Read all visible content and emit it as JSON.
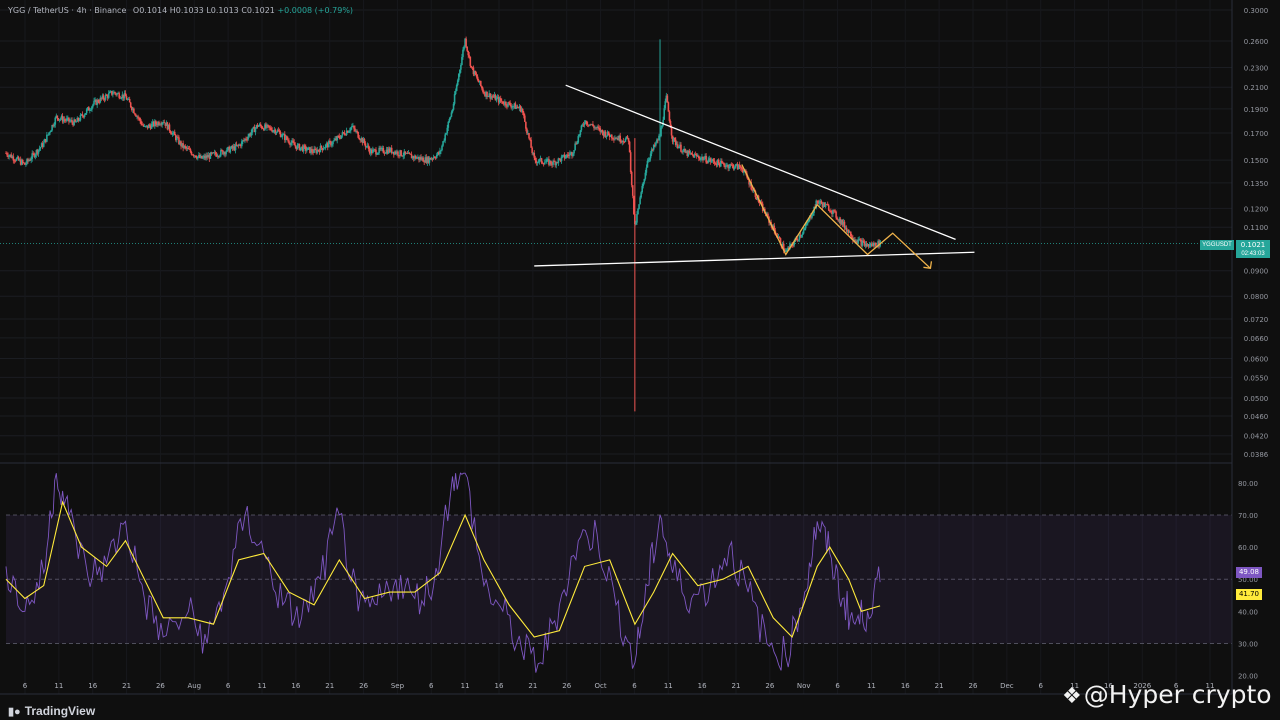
{
  "header": {
    "symbol": "YGG / TetherUS · 4h · Binance",
    "open": "O0.1014",
    "high": "H0.1033",
    "low": "L0.1013",
    "close": "C0.1021",
    "change": "+0.0008 (+0.79%)"
  },
  "price_tags": {
    "symbol": "YGGUSDT",
    "current": "0.1021",
    "countdown": "02:43:03"
  },
  "rsi_tags": {
    "rsi": "49.08",
    "rsi_ma": "41.70"
  },
  "colors": {
    "background": "#0f0f0f",
    "bull": "#26a69a",
    "bear": "#ef5350",
    "rsi_line": "#7e57c2",
    "rsi_ma": "#ffeb3b",
    "pattern": "#f0b34b",
    "trendline": "#ffffff"
  },
  "branding": {
    "logo_text": "TradingView",
    "watermark": "@Hyper  crypto"
  },
  "chart_data": [
    {
      "type": "candlestick",
      "pair": "YGG/USDT",
      "interval": "4h",
      "scale": "log",
      "ylim": [
        0.0386,
        0.3
      ],
      "y_ticks": [
        "0.3000",
        "0.2600",
        "0.2300",
        "0.2100",
        "0.1900",
        "0.1700",
        "0.1500",
        "0.1350",
        "0.1200",
        "0.1100",
        "0.0900",
        "0.0800",
        "0.0720",
        "0.0660",
        "0.0600",
        "0.0550",
        "0.0500",
        "0.0460",
        "0.0420",
        "0.0386"
      ],
      "x_ticks": [
        "6",
        "11",
        "16",
        "21",
        "26",
        "Aug",
        "6",
        "11",
        "16",
        "21",
        "26",
        "Sep",
        "6",
        "11",
        "16",
        "21",
        "26",
        "Oct",
        "6",
        "11",
        "16",
        "21",
        "26",
        "Nov",
        "6",
        "11",
        "16",
        "21",
        "26",
        "Dec",
        "6",
        "11",
        "16",
        "2026",
        "6",
        "11"
      ],
      "x_range": [
        "2025-07-03",
        "2026-01-13"
      ],
      "series_close": [
        [
          "2025-07-03",
          0.155
        ],
        [
          "2025-07-06",
          0.147
        ],
        [
          "2025-07-09",
          0.162
        ],
        [
          "2025-07-11",
          0.183
        ],
        [
          "2025-07-14",
          0.178
        ],
        [
          "2025-07-17",
          0.195
        ],
        [
          "2025-07-20",
          0.205
        ],
        [
          "2025-07-22",
          0.201
        ],
        [
          "2025-07-25",
          0.174
        ],
        [
          "2025-07-28",
          0.18
        ],
        [
          "2025-07-31",
          0.16
        ],
        [
          "2025-08-03",
          0.151
        ],
        [
          "2025-08-06",
          0.155
        ],
        [
          "2025-08-09",
          0.16
        ],
        [
          "2025-08-12",
          0.176
        ],
        [
          "2025-08-15",
          0.172
        ],
        [
          "2025-08-18",
          0.16
        ],
        [
          "2025-08-21",
          0.156
        ],
        [
          "2025-08-24",
          0.163
        ],
        [
          "2025-08-27",
          0.175
        ],
        [
          "2025-08-30",
          0.156
        ],
        [
          "2025-09-02",
          0.157
        ],
        [
          "2025-09-05",
          0.153
        ],
        [
          "2025-09-08",
          0.15
        ],
        [
          "2025-09-10",
          0.155
        ],
        [
          "2025-09-12",
          0.19
        ],
        [
          "2025-09-14",
          0.262
        ],
        [
          "2025-09-15",
          0.23
        ],
        [
          "2025-09-17",
          0.205
        ],
        [
          "2025-09-20",
          0.196
        ],
        [
          "2025-09-23",
          0.19
        ],
        [
          "2025-09-25",
          0.15
        ],
        [
          "2025-09-28",
          0.148
        ],
        [
          "2025-10-01",
          0.155
        ],
        [
          "2025-10-03",
          0.18
        ],
        [
          "2025-10-06",
          0.17
        ],
        [
          "2025-10-09",
          0.165
        ],
        [
          "2025-10-10",
          0.165
        ],
        [
          "2025-10-11",
          0.11
        ],
        [
          "2025-10-13",
          0.15
        ],
        [
          "2025-10-15",
          0.168
        ],
        [
          "2025-10-16",
          0.2
        ],
        [
          "2025-10-17",
          0.165
        ],
        [
          "2025-10-19",
          0.155
        ],
        [
          "2025-10-22",
          0.151
        ],
        [
          "2025-10-25",
          0.147
        ],
        [
          "2025-10-28",
          0.145
        ],
        [
          "2025-10-31",
          0.122
        ],
        [
          "2025-11-04",
          0.098
        ],
        [
          "2025-11-07",
          0.109
        ],
        [
          "2025-11-09",
          0.124
        ],
        [
          "2025-11-11",
          0.12
        ],
        [
          "2025-11-13",
          0.112
        ],
        [
          "2025-11-15",
          0.104
        ],
        [
          "2025-11-17",
          0.101
        ],
        [
          "2025-11-19",
          0.1021
        ]
      ],
      "wicks": {
        "2025-10-11": {
          "low": 0.047,
          "high": 0.166
        },
        "2025-10-15": {
          "low": 0.15,
          "high": 0.262
        }
      },
      "annotations": {
        "descending_trendline": [
          [
            "2025-09-30",
            0.212
          ],
          [
            "2025-12-01",
            0.104
          ]
        ],
        "support_line": [
          [
            "2025-09-25",
            0.092
          ],
          [
            "2025-12-04",
            0.098
          ]
        ],
        "pattern_path": [
          [
            "2025-10-28",
            0.147
          ],
          [
            "2025-11-04",
            0.097
          ],
          [
            "2025-11-09",
            0.122
          ],
          [
            "2025-11-17",
            0.097
          ],
          [
            "2025-11-21",
            0.107
          ],
          [
            "2025-11-27",
            0.091
          ]
        ]
      }
    },
    {
      "type": "line",
      "indicator": "RSI",
      "ylim": [
        18,
        84
      ],
      "y_ticks": [
        "80.00",
        "70.00",
        "60.00",
        "50.00",
        "40.00",
        "30.00",
        "20.00"
      ],
      "band": [
        30,
        70
      ],
      "midline": 50,
      "series": [
        {
          "name": "RSI",
          "values": [
            [
              "2025-07-03",
              54
            ],
            [
              "2025-07-06",
              40
            ],
            [
              "2025-07-09",
              52
            ],
            [
              "2025-07-11",
              84
            ],
            [
              "2025-07-13",
              70
            ],
            [
              "2025-07-16",
              51
            ],
            [
              "2025-07-19",
              55
            ],
            [
              "2025-07-22",
              68
            ],
            [
              "2025-07-25",
              44
            ],
            [
              "2025-07-28",
              32
            ],
            [
              "2025-08-01",
              40
            ],
            [
              "2025-08-04",
              30
            ],
            [
              "2025-08-07",
              48
            ],
            [
              "2025-08-10",
              70
            ],
            [
              "2025-08-13",
              58
            ],
            [
              "2025-08-16",
              42
            ],
            [
              "2025-08-19",
              38
            ],
            [
              "2025-08-22",
              50
            ],
            [
              "2025-08-25",
              70
            ],
            [
              "2025-08-28",
              40
            ],
            [
              "2025-08-31",
              42
            ],
            [
              "2025-09-03",
              50
            ],
            [
              "2025-09-06",
              44
            ],
            [
              "2025-09-09",
              48
            ],
            [
              "2025-09-12",
              82
            ],
            [
              "2025-09-14",
              84
            ],
            [
              "2025-09-17",
              48
            ],
            [
              "2025-09-20",
              40
            ],
            [
              "2025-09-23",
              28
            ],
            [
              "2025-09-26",
              24
            ],
            [
              "2025-09-29",
              42
            ],
            [
              "2025-10-02",
              62
            ],
            [
              "2025-10-05",
              64
            ],
            [
              "2025-10-08",
              42
            ],
            [
              "2025-10-11",
              24
            ],
            [
              "2025-10-13",
              48
            ],
            [
              "2025-10-15",
              70
            ],
            [
              "2025-10-17",
              52
            ],
            [
              "2025-10-20",
              44
            ],
            [
              "2025-10-23",
              48
            ],
            [
              "2025-10-26",
              60
            ],
            [
              "2025-10-29",
              46
            ],
            [
              "2025-11-01",
              30
            ],
            [
              "2025-11-04",
              26
            ],
            [
              "2025-11-07",
              46
            ],
            [
              "2025-11-09",
              68
            ],
            [
              "2025-11-11",
              58
            ],
            [
              "2025-11-13",
              44
            ],
            [
              "2025-11-15",
              36
            ],
            [
              "2025-11-17",
              40
            ],
            [
              "2025-11-19",
              49.08
            ]
          ]
        },
        {
          "name": "RSI MA",
          "values": [
            [
              "2025-07-03",
              50
            ],
            [
              "2025-07-06",
              44
            ],
            [
              "2025-07-09",
              48
            ],
            [
              "2025-07-12",
              74
            ],
            [
              "2025-07-15",
              60
            ],
            [
              "2025-07-19",
              54
            ],
            [
              "2025-07-22",
              62
            ],
            [
              "2025-07-25",
              50
            ],
            [
              "2025-07-28",
              38
            ],
            [
              "2025-08-01",
              38
            ],
            [
              "2025-08-05",
              36
            ],
            [
              "2025-08-09",
              56
            ],
            [
              "2025-08-13",
              58
            ],
            [
              "2025-08-17",
              46
            ],
            [
              "2025-08-21",
              42
            ],
            [
              "2025-08-25",
              56
            ],
            [
              "2025-08-29",
              44
            ],
            [
              "2025-09-02",
              46
            ],
            [
              "2025-09-06",
              46
            ],
            [
              "2025-09-10",
              52
            ],
            [
              "2025-09-14",
              70
            ],
            [
              "2025-09-17",
              56
            ],
            [
              "2025-09-21",
              42
            ],
            [
              "2025-09-25",
              32
            ],
            [
              "2025-09-29",
              34
            ],
            [
              "2025-10-03",
              54
            ],
            [
              "2025-10-07",
              56
            ],
            [
              "2025-10-11",
              36
            ],
            [
              "2025-10-14",
              46
            ],
            [
              "2025-10-17",
              58
            ],
            [
              "2025-10-21",
              48
            ],
            [
              "2025-10-25",
              50
            ],
            [
              "2025-10-29",
              54
            ],
            [
              "2025-11-02",
              38
            ],
            [
              "2025-11-05",
              32
            ],
            [
              "2025-11-09",
              54
            ],
            [
              "2025-11-11",
              60
            ],
            [
              "2025-11-14",
              50
            ],
            [
              "2025-11-16",
              40
            ],
            [
              "2025-11-19",
              41.7
            ]
          ]
        }
      ]
    }
  ]
}
